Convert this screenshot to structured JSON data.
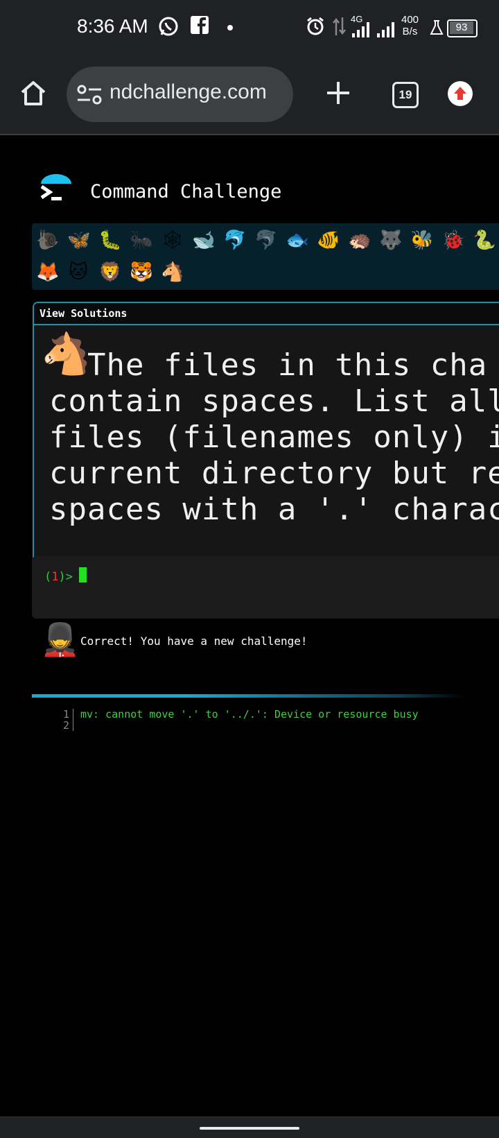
{
  "status_bar": {
    "time": "8:36 AM",
    "network_type": "4G",
    "data_speed_value": "400",
    "data_speed_unit": "B/s",
    "battery": "93"
  },
  "browser": {
    "url_display": "ndchallenge.com",
    "tab_count": "19"
  },
  "app": {
    "title": "Command Challenge",
    "animals_row1": [
      "🐌",
      "🦋",
      "🐛",
      "🐜",
      "🕸",
      "🐋",
      "🐬",
      "🐬",
      "🐟",
      "🐠",
      "🦔",
      "🐺",
      "🐝",
      "🐞",
      "🐍"
    ],
    "animals_row2": [
      "🦊",
      "🐱",
      "🦁",
      "🐯",
      "🐴"
    ],
    "view_solutions": "View Solutions",
    "challenge_icon": "🐴",
    "challenge_lines": [
      "  The files in this cha",
      "contain spaces. List all",
      "files (filenames only) i",
      "current directory but re",
      "spaces with a '.' charac"
    ],
    "prompt_open": "(",
    "prompt_number": "1",
    "prompt_close": ")>",
    "mascot": "💂",
    "message": "Correct! You have a new challenge!",
    "output_lines": [
      {
        "no": "1",
        "text": "mv: cannot move '.' to '../.': Device or resource busy"
      },
      {
        "no": "2",
        "text": ""
      }
    ]
  }
}
